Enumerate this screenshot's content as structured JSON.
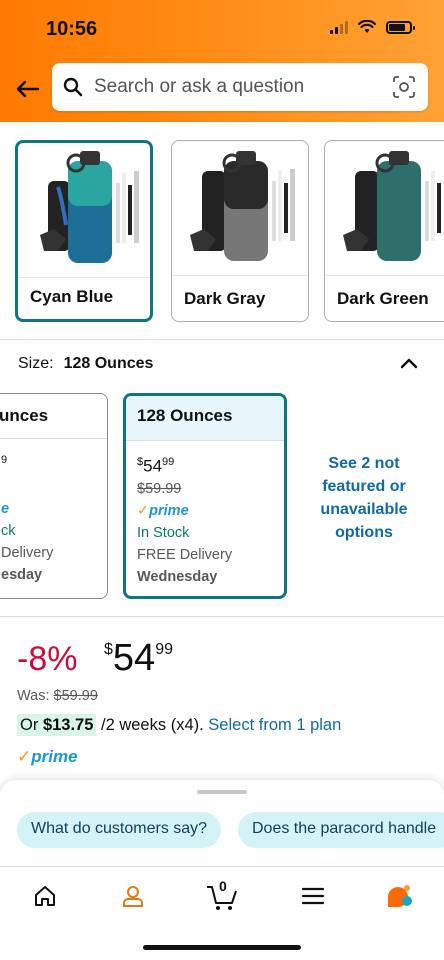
{
  "status_bar": {
    "time": "10:56"
  },
  "search": {
    "placeholder": "Search or ask a question"
  },
  "colors": {
    "options": [
      {
        "label": "Cyan Blue"
      },
      {
        "label": "Dark Gray"
      },
      {
        "label": "Dark Green"
      }
    ],
    "accent": "#0f7583"
  },
  "size": {
    "label": "Size:",
    "selected": "128 Ounces",
    "options": [
      {
        "title": "unces",
        "price_whole": "",
        "price_cents": "9",
        "was": "",
        "prime": "e",
        "stock": "ck",
        "delivery": "Delivery",
        "day": "esday"
      },
      {
        "title": "128 Ounces",
        "price_whole": "54",
        "price_cents": "99",
        "was": "$59.99",
        "prime": "prime",
        "stock": "In Stock",
        "delivery": "FREE Delivery",
        "day": "Wednesday"
      }
    ],
    "see_more": "See 2 not featured or unavailable options"
  },
  "price": {
    "discount": "-8%",
    "currency": "$",
    "whole": "54",
    "cents": "99",
    "was_label": "Was:",
    "was_value": "$59.99",
    "installment_prefix": "Or",
    "installment_amount": "$13.75",
    "installment_terms": "/2 weeks (x4).",
    "installment_link": "Select from 1 plan",
    "prime": "prime"
  },
  "chips": [
    "What do customers say?",
    "Does the paracord handle"
  ],
  "nav": [
    "home-icon",
    "account-icon",
    "cart-icon",
    "menu-icon",
    "rufus-icon"
  ],
  "cart_count": "0"
}
